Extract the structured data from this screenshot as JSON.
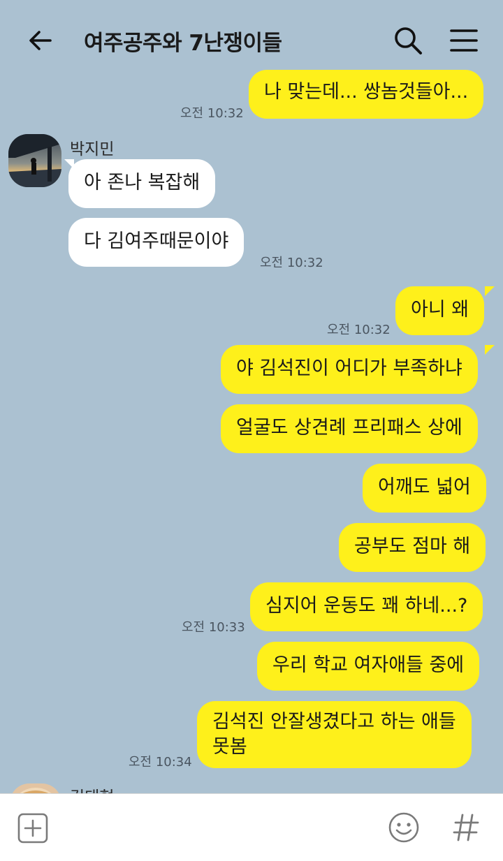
{
  "header": {
    "title": "여주공주와 7난쟁이들"
  },
  "messages": {
    "m1": {
      "text": "나 맞는데... 쌍놈것들아...",
      "time": "오전 10:32"
    },
    "sender1": "박지민",
    "m2": {
      "text": "아 존나 복잡해"
    },
    "m3": {
      "text": "다 김여주때문이야",
      "time": "오전 10:32"
    },
    "m4": {
      "text": "아니 왜",
      "time": "오전 10:32"
    },
    "m5": {
      "text": "야 김석진이 어디가 부족하냐"
    },
    "m6": {
      "text": "얼굴도 상견례 프리패스 상에"
    },
    "m7": {
      "text": "어깨도 넓어"
    },
    "m8": {
      "text": "공부도 점마 해"
    },
    "m9": {
      "text": "심지어 운동도 꽤 하네...?",
      "time": "오전 10:33"
    },
    "m10": {
      "text": "우리 학교 여자애들 중에"
    },
    "m11": {
      "line1": "김석진 안잘생겼다고 하는 애들",
      "line2": "못봄",
      "time": "오전 10:34"
    },
    "sender2": "김태형"
  },
  "colors": {
    "background": "#abc1d1",
    "my_bubble": "#fef01b",
    "their_bubble": "#ffffff"
  },
  "icons": [
    "back-arrow-icon",
    "search-icon",
    "menu-icon",
    "plus-icon",
    "emoji-icon",
    "hashtag-icon"
  ]
}
